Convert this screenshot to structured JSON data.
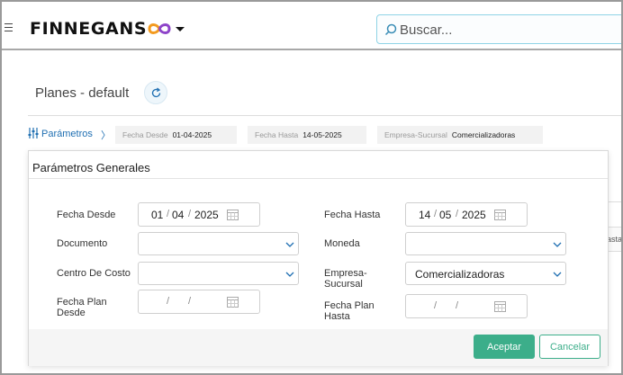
{
  "header": {
    "brand": "FINNEGANS",
    "search": {
      "placeholder": "Buscar..."
    },
    "colors": {
      "logo_orange": "#f39a1e",
      "logo_purple": "#8e44c9",
      "search_border": "#8fd4e6"
    }
  },
  "page": {
    "title": "Planes - default"
  },
  "filters": {
    "params_label": "Parámetros",
    "chips": [
      {
        "key": "Fecha Desde",
        "value": "01-04-2025"
      },
      {
        "key": "Fecha Hasta",
        "value": "14-05-2025"
      },
      {
        "key": "Empresa-Sucursal",
        "value": "Comercializadoras"
      }
    ]
  },
  "background": {
    "partial_text": "asta"
  },
  "dialog": {
    "title": "Parámetros Generales",
    "fields": {
      "fecha_desde": {
        "label": "Fecha Desde",
        "day": "01",
        "month": "04",
        "year": "2025"
      },
      "fecha_hasta": {
        "label": "Fecha Hasta",
        "day": "14",
        "month": "05",
        "year": "2025"
      },
      "documento": {
        "label": "Documento",
        "value": ""
      },
      "moneda": {
        "label": "Moneda",
        "value": ""
      },
      "centro_costo": {
        "label": "Centro De Costo",
        "value": ""
      },
      "empresa_sucursal": {
        "label_line1": "Empresa-",
        "label_line2": "Sucursal",
        "value": "Comercializadoras"
      },
      "fecha_plan_desde": {
        "label_line1": "Fecha Plan",
        "label_line2": "Desde"
      },
      "fecha_plan_hasta": {
        "label_line1": "Fecha Plan",
        "label_line2": "Hasta"
      },
      "date_sep": "/"
    },
    "buttons": {
      "accept": "Aceptar",
      "cancel": "Cancelar"
    },
    "colors": {
      "accept_bg": "#3cae8a",
      "link": "#1f6fb2"
    }
  }
}
